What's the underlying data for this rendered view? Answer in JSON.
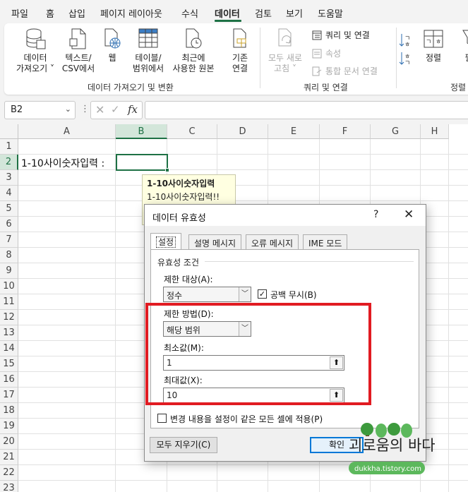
{
  "menu": {
    "tabs": [
      "파일",
      "홈",
      "삽입",
      "페이지 레이아웃",
      "수식",
      "데이터",
      "검토",
      "보기",
      "도움말"
    ],
    "active": "데이터"
  },
  "ribbon": {
    "get_data": "데이터\n가져오기 ˅",
    "from_text_csv": "텍스트/\nCSV에서",
    "from_web": "웹",
    "from_table_range": "테이블/\n범위에서",
    "recent_sources": "최근에\n사용한 원본",
    "existing_connections": "기존\n연결",
    "refresh_all": "모두 새로\n고침 ˅",
    "queries_connections": "쿼리 및 연결",
    "properties": "속성",
    "edit_links": "통합 문서 연결",
    "sort": "정렬",
    "filter": "필",
    "group_get_transform": "데이터 가져오기 및 변환",
    "group_queries": "쿼리 및 연결",
    "group_sort": "정렬"
  },
  "formula_bar": {
    "name_box": "B2",
    "fx_label": "fx",
    "formula": ""
  },
  "grid": {
    "columns": [
      "A",
      "B",
      "C",
      "D",
      "E",
      "F",
      "G",
      "H"
    ],
    "selected_column": "B",
    "rows": [
      "1",
      "2",
      "3",
      "4",
      "5",
      "6",
      "7",
      "8",
      "9",
      "10",
      "11",
      "12",
      "13",
      "14",
      "15",
      "16",
      "17",
      "18",
      "19",
      "20",
      "21",
      "22",
      "23"
    ],
    "selected_row": "2",
    "cell_a2": "1-10사이숫자입력 :"
  },
  "tooltip": {
    "title": "1-10사이숫자입력",
    "message": "1-10사이숫자입력!!"
  },
  "dialog": {
    "title": "데이터 유효성",
    "help": "?",
    "close": "✕",
    "tabs": [
      "설정",
      "설명 메시지",
      "오류 메시지",
      "IME 모드"
    ],
    "active_tab": "설정",
    "section": "유효성 조건",
    "allow_label": "제한 대상(A):",
    "allow_value": "정수",
    "ignore_blank_label": "공백 무시(B)",
    "ignore_blank_checked": true,
    "data_label": "제한 방법(D):",
    "data_value": "해당 범위",
    "min_label": "최소값(M):",
    "min_value": "1",
    "max_label": "최대값(X):",
    "max_value": "10",
    "apply_all_label": "변경 내용을 설정이 같은 모든 셀에 적용(P)",
    "apply_all_checked": false,
    "clear_all": "모두 지우기(C)",
    "ok": "확인"
  },
  "watermark": {
    "title": "괴로움의 바다",
    "url": "dukkha.tistory.com"
  },
  "colors": {
    "excel_green": "#1e7145",
    "highlight_red": "#e11b22",
    "dialog_bg": "#f0f0f0"
  }
}
